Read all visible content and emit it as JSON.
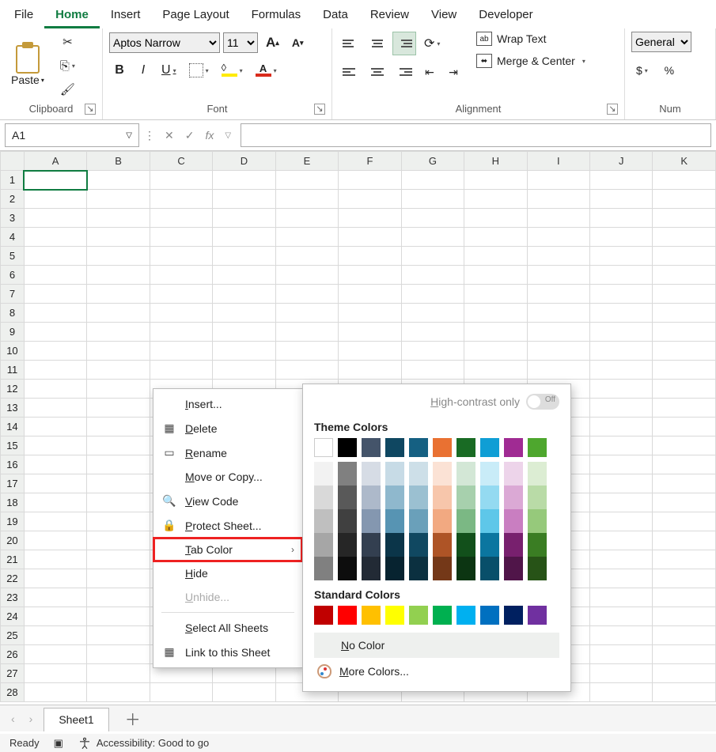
{
  "menu": {
    "file": "File",
    "home": "Home",
    "insert": "Insert",
    "page_layout": "Page Layout",
    "formulas": "Formulas",
    "data": "Data",
    "review": "Review",
    "view": "View",
    "developer": "Developer"
  },
  "ribbon": {
    "clipboard": {
      "label": "Clipboard",
      "paste": "Paste"
    },
    "font": {
      "label": "Font",
      "name": "Aptos Narrow",
      "size": "11",
      "bold": "B",
      "italic": "I",
      "underline": "U",
      "incA": "A",
      "decA": "A"
    },
    "alignment": {
      "label": "Alignment",
      "wrap": "Wrap Text",
      "merge": "Merge & Center"
    },
    "number": {
      "label": "Num",
      "format": "General",
      "currency": "$",
      "percent": "%"
    }
  },
  "bar": {
    "namebox": "A1",
    "fx": "fx",
    "cancel": "✕",
    "enter": "✓",
    "formula": ""
  },
  "sheet": {
    "columns": [
      "A",
      "B",
      "C",
      "D",
      "E",
      "F",
      "G",
      "H",
      "I",
      "J",
      "K"
    ],
    "rows": [
      "1",
      "2",
      "3",
      "4",
      "5",
      "6",
      "7",
      "8",
      "9",
      "10",
      "11",
      "12",
      "13",
      "14",
      "15",
      "16",
      "17",
      "18",
      "19",
      "20",
      "21",
      "22",
      "23",
      "24",
      "25",
      "26",
      "27",
      "28"
    ],
    "tab": "Sheet1"
  },
  "ctx": {
    "insert": "Insert...",
    "delete": "Delete",
    "rename": "Rename",
    "move": "Move or Copy...",
    "viewcode": "View Code",
    "protect": "Protect Sheet...",
    "tabcolor": "Tab Color",
    "hide": "Hide",
    "unhide": "Unhide...",
    "selectall": "Select All Sheets",
    "link": "Link to this Sheet"
  },
  "colors": {
    "hc": "High-contrast only",
    "hc_state": "Off",
    "theme_title": "Theme Colors",
    "theme_row": [
      "#ffffff",
      "#000000",
      "#44546a",
      "#0f4761",
      "#156082",
      "#e97132",
      "#196b24",
      "#0f9ed5",
      "#a02b93",
      "#4ea72e"
    ],
    "theme_grid": [
      [
        "#f2f2f2",
        "#808080",
        "#d6dce5",
        "#c7dbe6",
        "#cddfe8",
        "#fbe2d5",
        "#d3e7d6",
        "#c9ecf8",
        "#edd4ea",
        "#dcedd3"
      ],
      [
        "#d9d9d9",
        "#595959",
        "#adb9ca",
        "#8fb8cd",
        "#9bc0d1",
        "#f7c6ab",
        "#a7d0ad",
        "#94daf1",
        "#dba9d5",
        "#b9dba7"
      ],
      [
        "#bfbfbf",
        "#404040",
        "#8497b0",
        "#5794b3",
        "#6aa0ba",
        "#f2a981",
        "#7bb884",
        "#5ec7e9",
        "#c97ec1",
        "#96c97b"
      ],
      [
        "#a6a6a6",
        "#262626",
        "#333f50",
        "#0b3549",
        "#104861",
        "#ae5426",
        "#12501b",
        "#0b76a0",
        "#78206e",
        "#3a7d23"
      ],
      [
        "#808080",
        "#0d0d0d",
        "#222a35",
        "#072330",
        "#0b3040",
        "#743818",
        "#0c3512",
        "#084f6a",
        "#501549",
        "#275317"
      ]
    ],
    "std_title": "Standard Colors",
    "std": [
      "#c00000",
      "#ff0000",
      "#ffc000",
      "#ffff00",
      "#92d050",
      "#00b050",
      "#00b0f0",
      "#0070c0",
      "#002060",
      "#7030a0"
    ],
    "nocolor": "No Color",
    "more": "More Colors..."
  },
  "status": {
    "ready": "Ready",
    "acc": "Accessibility: Good to go"
  }
}
